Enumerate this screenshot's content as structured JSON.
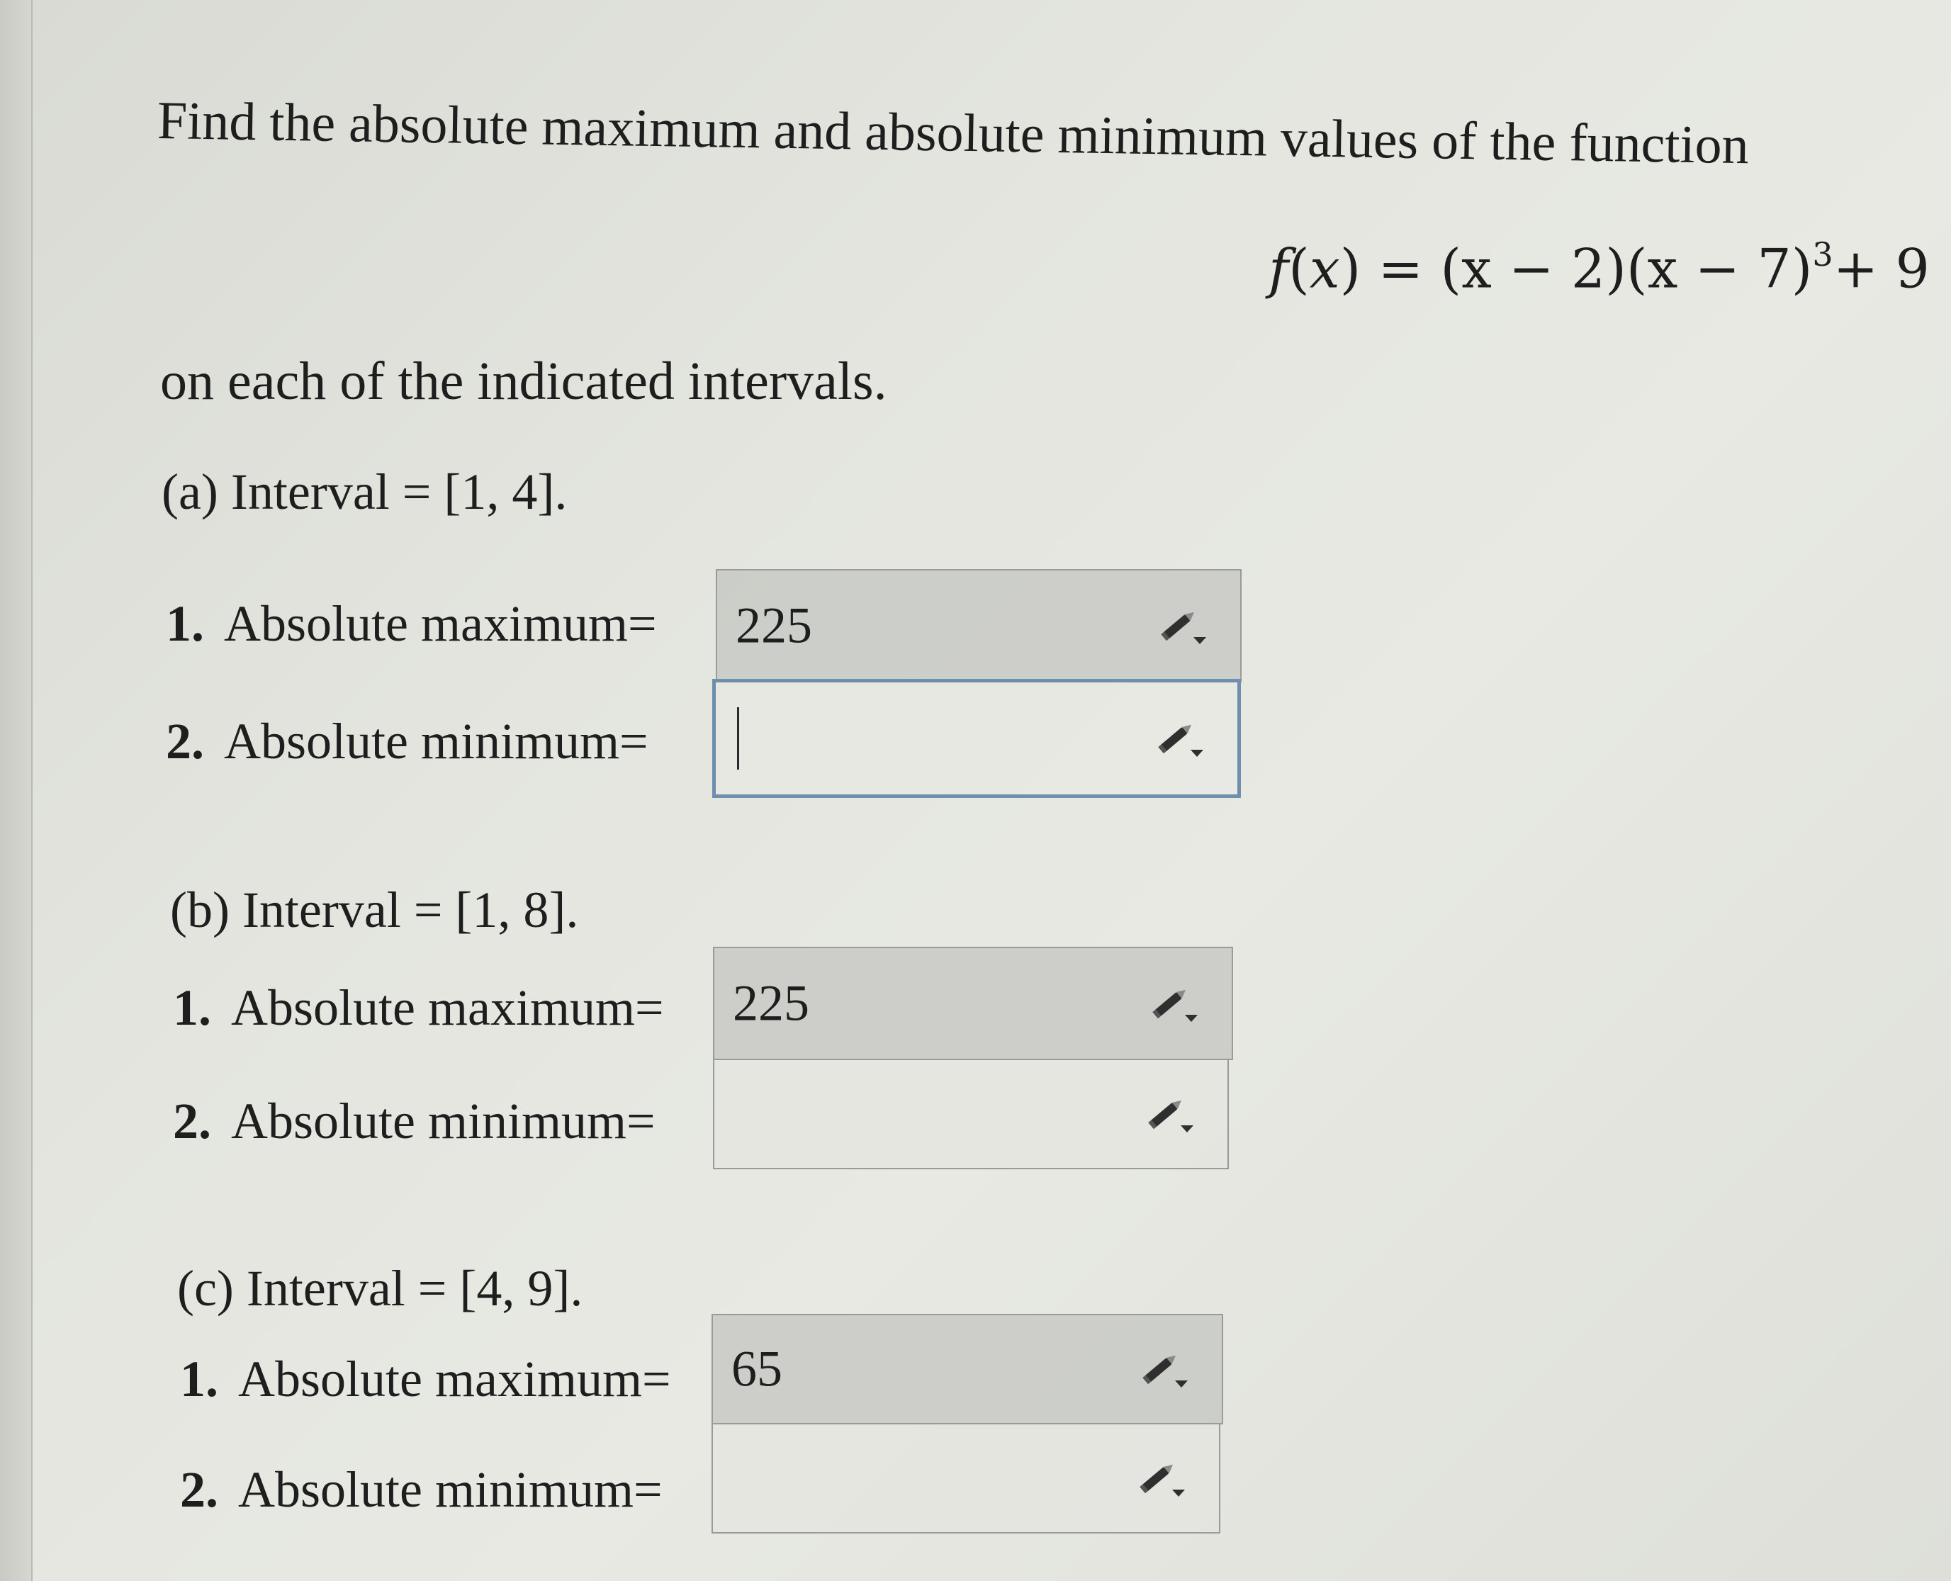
{
  "problem": {
    "intro": "Find the absolute maximum and absolute minimum values of the function",
    "formula_lhs": "f",
    "formula_var": "x",
    "formula_text_1": "(x − 2)(x − 7)",
    "formula_exp": "3",
    "formula_tail": "+ 9",
    "subtitle": "on each of the indicated intervals."
  },
  "parts": [
    {
      "interval_label": "(a) Interval = [1, 4].",
      "questions": [
        {
          "number": "1.",
          "label": "Absolute maximum=",
          "value": "225"
        },
        {
          "number": "2.",
          "label": "Absolute minimum=",
          "value": ""
        }
      ]
    },
    {
      "interval_label": "(b) Interval = [1, 8].",
      "questions": [
        {
          "number": "1.",
          "label": "Absolute maximum=",
          "value": "225"
        },
        {
          "number": "2.",
          "label": "Absolute minimum=",
          "value": ""
        }
      ]
    },
    {
      "interval_label": "(c) Interval = [4, 9].",
      "questions": [
        {
          "number": "1.",
          "label": "Absolute maximum=",
          "value": "65"
        },
        {
          "number": "2.",
          "label": "Absolute minimum=",
          "value": ""
        }
      ]
    }
  ],
  "icons": {
    "edit": "pencil-dropdown-icon"
  },
  "colors": {
    "focus_border": "#6f8fae",
    "filled_bg": "#c8c9c4"
  }
}
